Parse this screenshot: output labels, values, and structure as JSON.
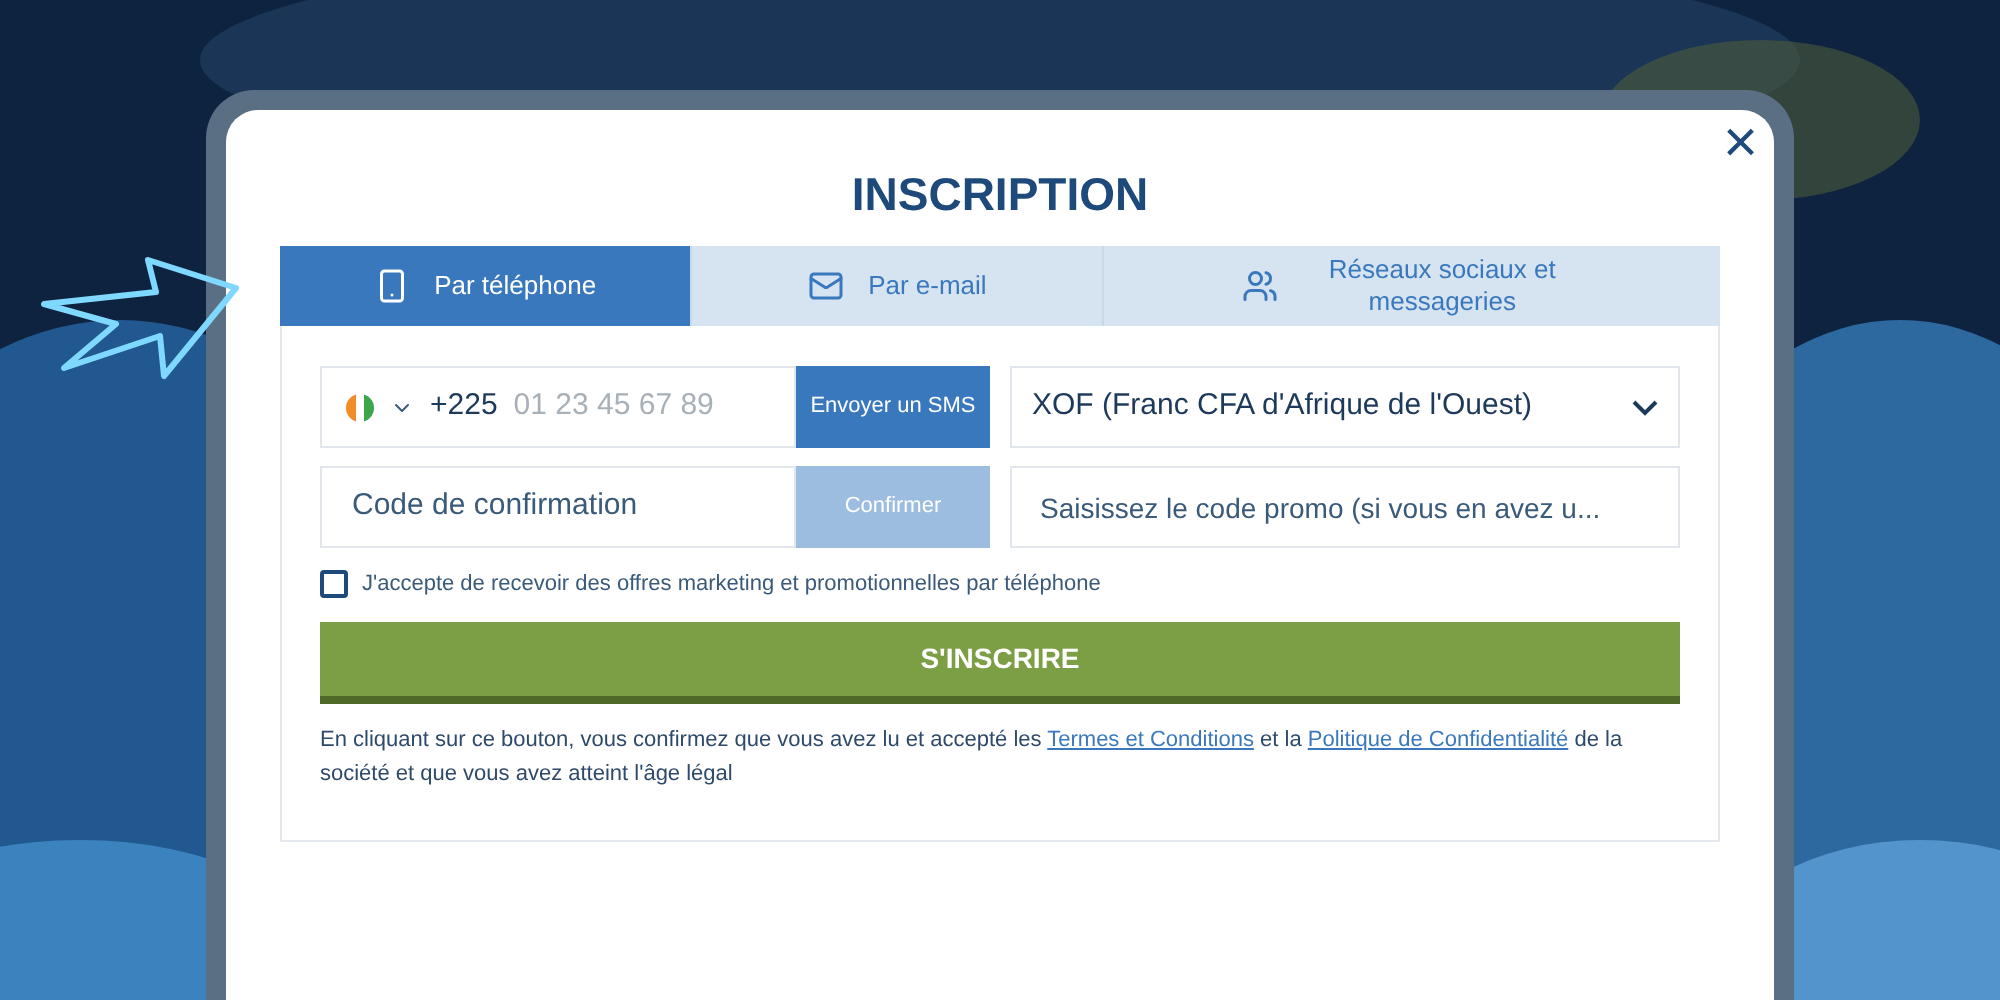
{
  "dialog": {
    "title": "INSCRIPTION",
    "close": "×"
  },
  "tabs": [
    {
      "label": "Par téléphone",
      "kind": "phone",
      "selected": true
    },
    {
      "label": "Par e-mail",
      "kind": "mail",
      "selected": false
    },
    {
      "label": "Réseaux sociaux et messageries",
      "kind": "users",
      "selected": false
    }
  ],
  "phone": {
    "prefix": "+225",
    "placeholder": "01 23 45 67 89",
    "button": "Envoyer un SMS"
  },
  "currency": {
    "value": "XOF (Franc CFA d'Afrique de l'Ouest)"
  },
  "confirmation": {
    "placeholder": "Code de confirmation",
    "button": "Confirmer",
    "disabled": true
  },
  "promo": {
    "placeholder": "Saisissez le code promo (si vous en avez u..."
  },
  "marketing": {
    "label": "J'accepte de recevoir des offres marketing et promotionnelles par téléphone",
    "checked": false
  },
  "submit": "S'INSCRIRE",
  "legal": {
    "before": "En cliquant sur ce bouton, vous confirmez que vous avez lu et accepté les",
    "link_1": "Termes et Conditions",
    "middle": "et la",
    "link_2": "Politique de Confidentialité",
    "after": "de la société et que vous avez atteint l'âge légal"
  }
}
